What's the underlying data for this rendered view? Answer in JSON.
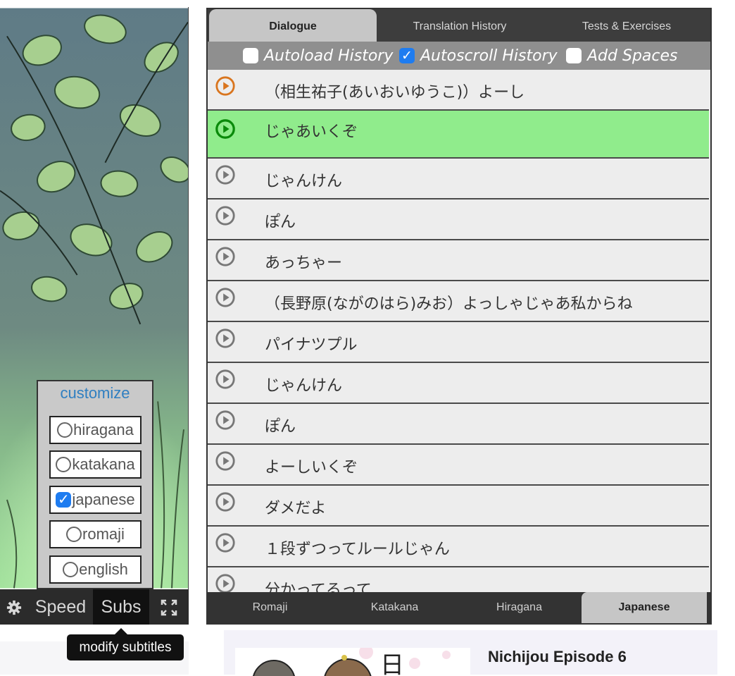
{
  "video": {
    "controls": {
      "settings_icon": "gear-icon",
      "speed_label": "Speed",
      "subs_label": "Subs",
      "fullscreen_icon": "fullscreen-icon"
    },
    "customize": {
      "title": "customize",
      "options": [
        {
          "label": "hiragana",
          "checked": false
        },
        {
          "label": "katakana",
          "checked": false
        },
        {
          "label": "japanese",
          "checked": true
        },
        {
          "label": "romaji",
          "checked": false
        },
        {
          "label": "english",
          "checked": false
        }
      ]
    },
    "tooltip": "modify subtitles"
  },
  "dialogue_panel": {
    "top_tabs": [
      {
        "label": "Dialogue",
        "active": true
      },
      {
        "label": "Translation History",
        "active": false
      },
      {
        "label": "Tests & Exercises",
        "active": false
      }
    ],
    "options": [
      {
        "label": "Autoload History",
        "checked": false
      },
      {
        "label": "Autoscroll History",
        "checked": true
      },
      {
        "label": "Add Spaces",
        "checked": false
      }
    ],
    "lines": [
      {
        "text": "（相生祐子(あいおいゆうこ)）よーし",
        "state": "played"
      },
      {
        "text": "じゃあいくぞ",
        "state": "active"
      },
      {
        "text": "じゃんけん",
        "state": "normal"
      },
      {
        "text": "ぽん",
        "state": "normal"
      },
      {
        "text": "あっちゃー",
        "state": "normal"
      },
      {
        "text": "（長野原(ながのはら)みお）よっしゃじゃあ私からね",
        "state": "normal"
      },
      {
        "text": "パイナツプル",
        "state": "normal"
      },
      {
        "text": "じゃんけん",
        "state": "normal"
      },
      {
        "text": "ぽん",
        "state": "normal"
      },
      {
        "text": "よーしいくぞ",
        "state": "normal"
      },
      {
        "text": "ダメだよ",
        "state": "normal"
      },
      {
        "text": "１段ずつってルールじゃん",
        "state": "normal"
      },
      {
        "text": "分かってるって",
        "state": "normal"
      }
    ],
    "bottom_tabs": [
      {
        "label": "Romaji",
        "active": false
      },
      {
        "label": "Katakana",
        "active": false
      },
      {
        "label": "Hiragana",
        "active": false
      },
      {
        "label": "Japanese",
        "active": true
      }
    ],
    "colors": {
      "active_line": "#90ec8c",
      "active_play": "#0a8a0a",
      "played_play": "#d9751e",
      "default_play": "#777777"
    }
  },
  "episode": {
    "title": "Nichijou Episode 6",
    "thumb_glyph": "日"
  }
}
